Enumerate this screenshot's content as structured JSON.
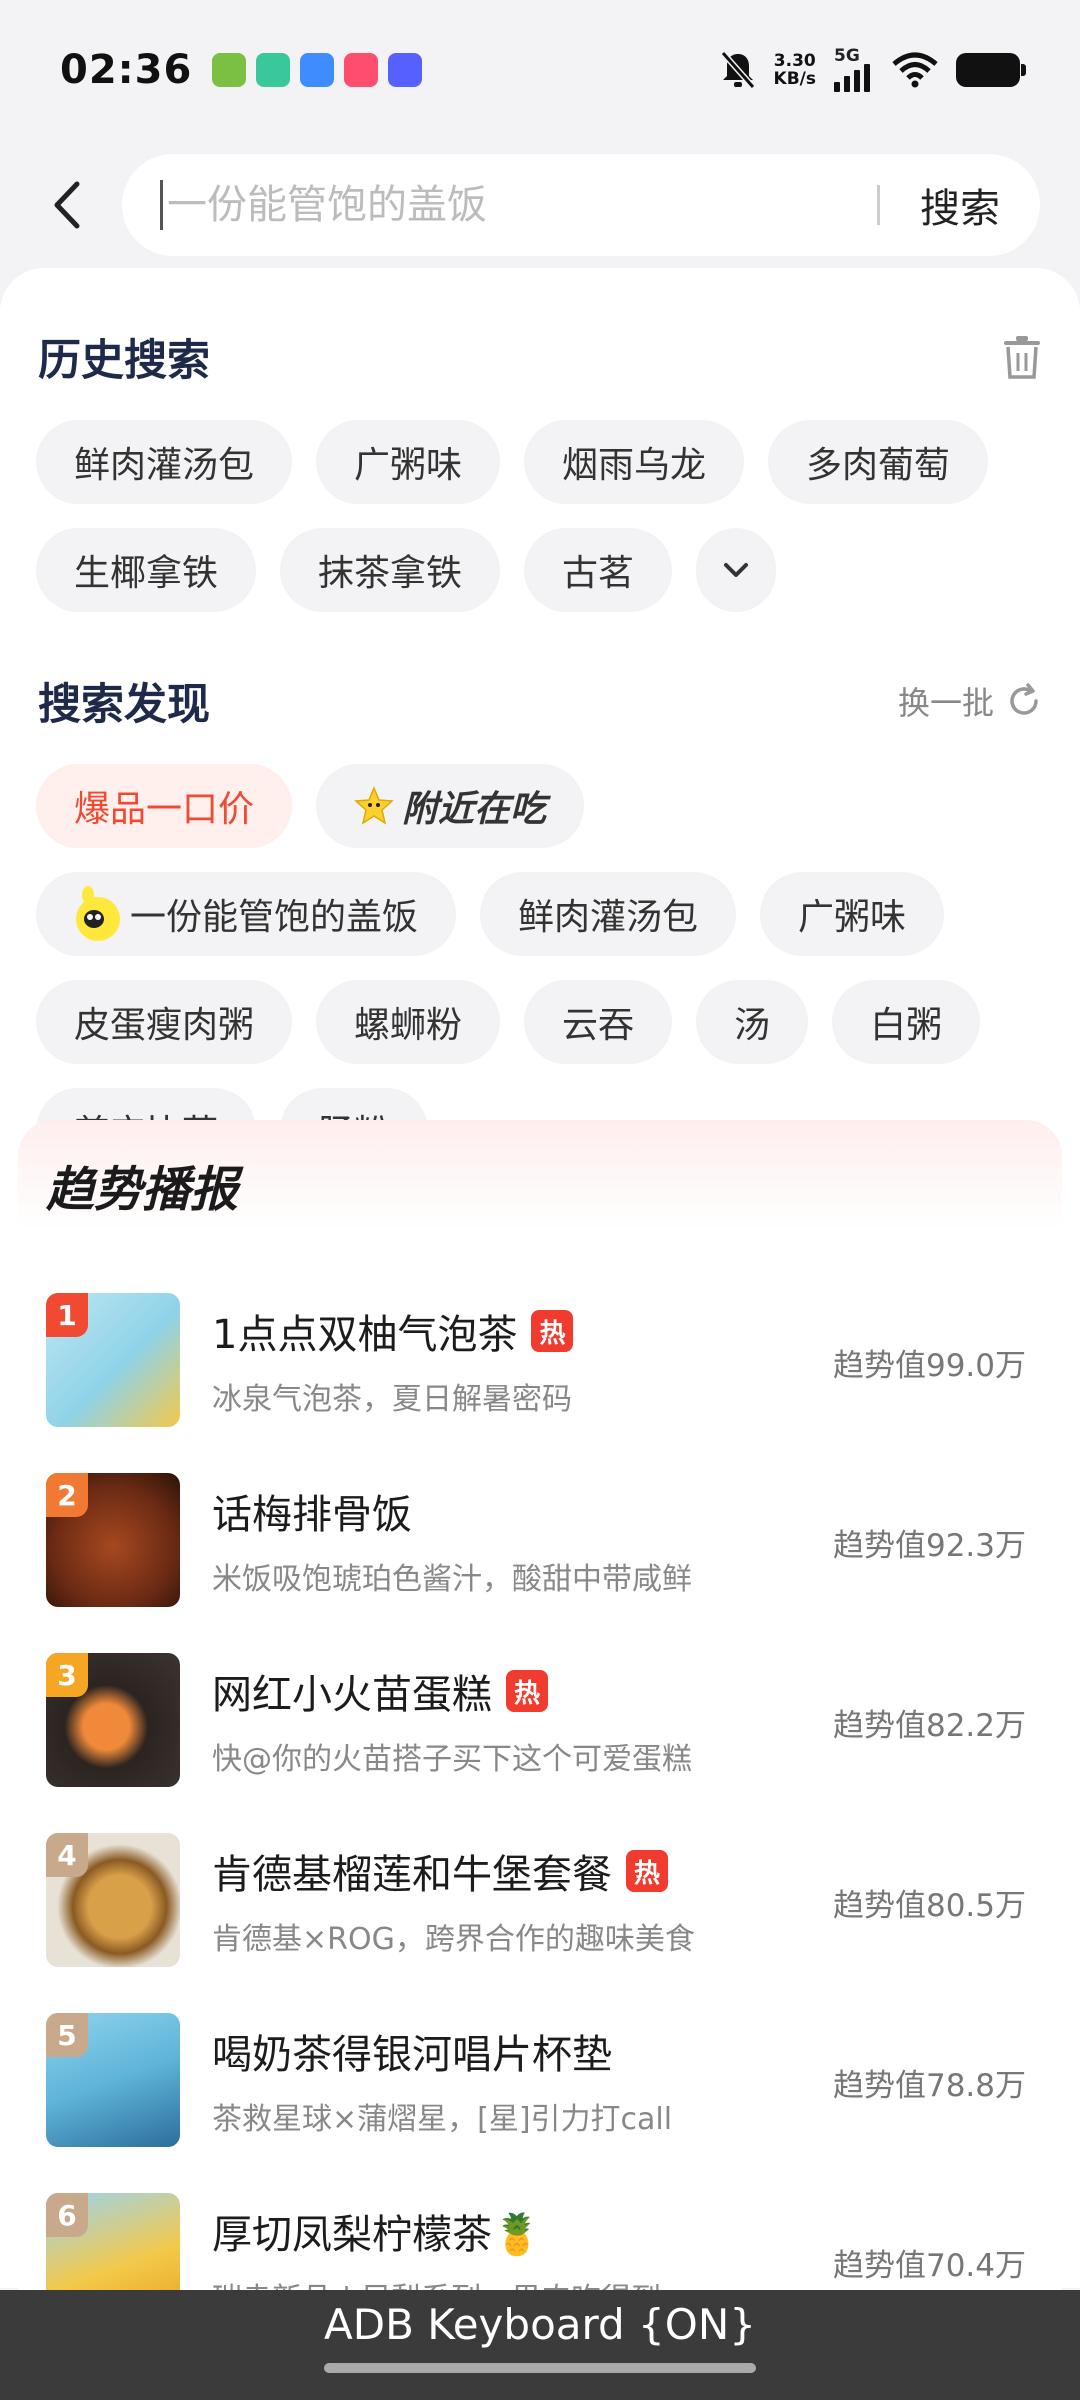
{
  "status_bar": {
    "time": "02:36",
    "net_speed_value": "3.30",
    "net_speed_unit": "KB/s",
    "network": "5G",
    "app_icon_colors": [
      "#7bc043",
      "#38c89b",
      "#3f8cff",
      "#ff4d6d",
      "#5660ff"
    ]
  },
  "search": {
    "placeholder": "一份能管饱的盖饭",
    "button_label": "搜索"
  },
  "history": {
    "title": "历史搜索",
    "items": [
      "鲜肉灌汤包",
      "广粥味",
      "烟雨乌龙",
      "多肉葡萄",
      "生椰拿铁",
      "抹茶拿铁",
      "古茗"
    ]
  },
  "discover": {
    "title": "搜索发现",
    "refresh_label": "换一批",
    "items": [
      "爆品一口价",
      "附近在吃",
      "一份能管饱的盖饭",
      "鲜肉灌汤包",
      "广粥味",
      "皮蛋瘦肉粥",
      "螺蛳粉",
      "云吞",
      "汤",
      "白粥",
      "尊宝比萨",
      "肠粉"
    ]
  },
  "trend": {
    "title": "趋势播报",
    "hot_label": "热",
    "items": [
      {
        "rank": "1",
        "title": "1点点双柚气泡茶",
        "hot": true,
        "sub": "冰泉气泡茶，夏日解暑密码",
        "score": "趋势值99.0万",
        "thumb_color": "#8fd3e8",
        "badge_color": "#f04a33"
      },
      {
        "rank": "2",
        "title": "话梅排骨饭",
        "hot": false,
        "sub": "米饭吸饱琥珀色酱汁，酸甜中带咸鲜",
        "score": "趋势值92.3万",
        "thumb_color": "#6b2a14",
        "badge_color": "#f07a33"
      },
      {
        "rank": "3",
        "title": "网红小火苗蛋糕",
        "hot": true,
        "sub": "快@你的火苗搭子买下这个可爱蛋糕",
        "score": "趋势值82.2万",
        "thumb_color": "#2c2420",
        "badge_color": "#f5a623"
      },
      {
        "rank": "4",
        "title": "肯德基榴莲和牛堡套餐",
        "hot": true,
        "sub": "肯德基×ROG，跨界合作的趣味美食",
        "score": "趋势值80.5万",
        "thumb_color": "#c7953c",
        "badge_color": "#c8a98b"
      },
      {
        "rank": "5",
        "title": "喝奶茶得银河唱片杯垫",
        "hot": false,
        "sub": "茶救星球×蒲熠星，[星]引力打call",
        "score": "趋势值78.8万",
        "thumb_color": "#5fb4d9",
        "badge_color": "#c8a98b"
      },
      {
        "rank": "6",
        "title": "厚切凤梨柠檬茶🍍",
        "hot": false,
        "sub": "瑞幸新品 | 凤梨系列，果肉吃得到",
        "score": "趋势值70.4万",
        "thumb_color": "#f3c94a",
        "badge_color": "#c8a98b"
      }
    ]
  },
  "keyboard": {
    "label": "ADB Keyboard {ON}"
  }
}
